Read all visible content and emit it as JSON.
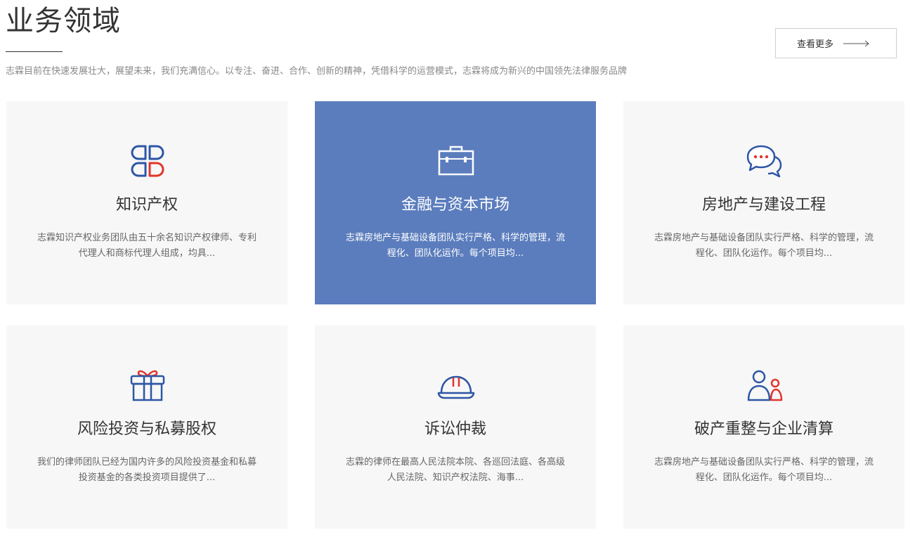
{
  "header": {
    "title": "业务领域",
    "subtitle": "志霖目前在快速发展壮大，展望未来，我们充满信心。以专注、奋进、合作、创新的精神，凭借科学的运营模式，志霖将成为新兴的中国领先法律服务品牌",
    "more_label": "查看更多"
  },
  "colors": {
    "accent_blue": "#5b7dbd",
    "icon_blue": "#2d56a6",
    "icon_red": "#e0352b",
    "card_bg": "#f7f7f7"
  },
  "cards": [
    {
      "icon": "clover-icon",
      "title": "知识产权",
      "desc": "志霖知识产权业务团队由五十余名知识产权律师、专利代理人和商标代理人组成，均具..."
    },
    {
      "icon": "briefcase-icon",
      "title": "金融与资本市场",
      "desc": "志霖房地产与基础设备团队实行严格、科学的管理，流程化、团队化运作。每个项目均..."
    },
    {
      "icon": "chat-bubbles-icon",
      "title": "房地产与建设工程",
      "desc": "志霖房地产与基础设备团队实行严格、科学的管理，流程化、团队化运作。每个项目均..."
    },
    {
      "icon": "gift-icon",
      "title": "风险投资与私募股权",
      "desc": "我们的律师团队已经为国内许多的风险投资基金和私募投资基金的各类投资项目提供了..."
    },
    {
      "icon": "helmet-icon",
      "title": "诉讼仲裁",
      "desc": "志霖的律师在最高人民法院本院、各巡回法庭、各高级人民法院、知识产权法院、海事..."
    },
    {
      "icon": "users-icon",
      "title": "破产重整与企业清算",
      "desc": "志霖房地产与基础设备团队实行严格、科学的管理，流程化、团队化运作。每个项目均..."
    }
  ]
}
